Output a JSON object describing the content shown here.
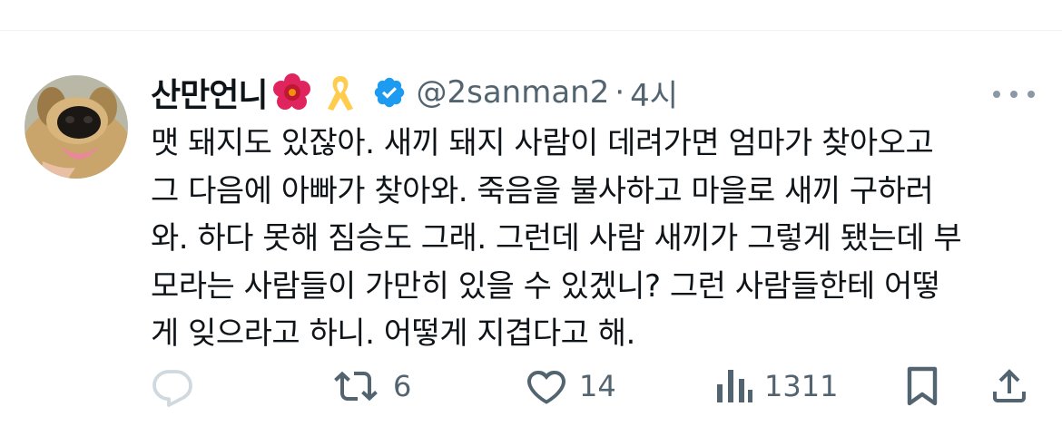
{
  "tweet": {
    "display_name": "산만언니",
    "emojis": [
      "hibiscus-emoji",
      "yellow-ribbon-emoji"
    ],
    "handle": "@2sanman2",
    "separator": "·",
    "time": "4시",
    "lines": [
      "맷 돼지도 있잖아. 새끼 돼지 사람이 데려가면 엄마가 찾아오고",
      "그 다음에 아빠가 찾아와. 죽음을 불사하고 마을로 새끼 구하러",
      "와. 하다 못해 짐승도 그래. 그런데 사람 새끼가 그렇게 됐는데 부",
      "모라는 사람들이 가만히 있을 수 있겠니? 그런 사람들한테 어떻",
      "게 잊으라고 하니. 어떻게 지겹다고 해."
    ]
  },
  "actions": {
    "reply_icon": "reply-icon",
    "retweet_icon": "retweet-icon",
    "retweet_count": "6",
    "like_icon": "heart-icon",
    "like_count": "14",
    "views_icon": "views-icon",
    "views_count": "1311",
    "bookmark_icon": "bookmark-icon",
    "share_icon": "share-icon"
  },
  "colors": {
    "text": "#0f1419",
    "secondary": "#536471",
    "verified": "#1d9bf0",
    "divider": "#eff3f4"
  }
}
